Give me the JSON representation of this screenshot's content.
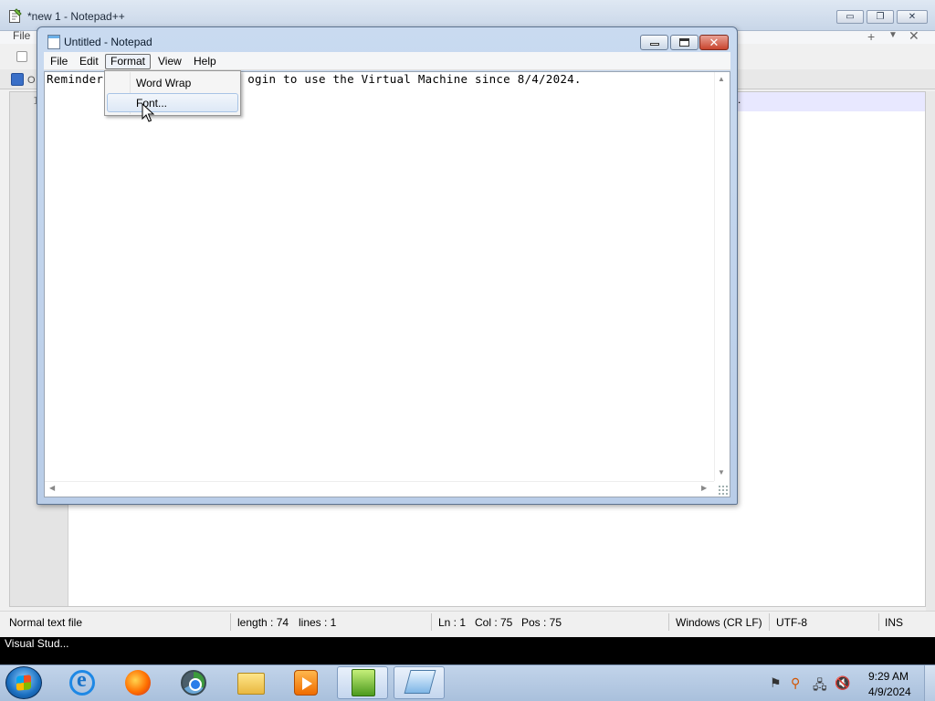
{
  "npp": {
    "title": "*new 1 - Notepad++",
    "window_controls": {
      "minimize": "▭",
      "maximize": "❐",
      "close": "✕"
    },
    "menu": {
      "file": "File",
      "plus": "+",
      "down": "▼",
      "close": "✕"
    },
    "tab_label": "O",
    "line_number": "1",
    "current_line_tail": ".",
    "status": {
      "file_type": "Normal text file",
      "length": "length : 74",
      "lines": "lines : 1",
      "ln": "Ln : 1",
      "col": "Col : 75",
      "pos": "Pos : 75",
      "eol": "Windows (CR LF)",
      "encoding": "UTF-8",
      "mode": "INS"
    }
  },
  "notepad": {
    "title": "Untitled - Notepad",
    "close_glyph": "✕",
    "menu": [
      "File",
      "Edit",
      "Format",
      "View",
      "Help"
    ],
    "text_left": "Reminder",
    "text_right": "ogin to use the Virtual Machine since 8/4/2024.",
    "scroll": {
      "up": "▲",
      "down": "▼",
      "left": "◀",
      "right": "▶"
    }
  },
  "format_menu": {
    "items": [
      "Word Wrap",
      "Font..."
    ],
    "highlighted": "Font..."
  },
  "tooltip_strip": "Visual Stud...",
  "tray": {
    "flag": "⚑",
    "search": "⚲",
    "network": "🖧",
    "volume": "🔇"
  },
  "clock": {
    "time": "9:29 AM",
    "date": "4/9/2024"
  },
  "colors": {
    "notepad_frame": "#b9cde8",
    "close_button": "#c9452e",
    "menu_highlight": "#dde8f6",
    "taskbar": "#a9c0dc"
  }
}
